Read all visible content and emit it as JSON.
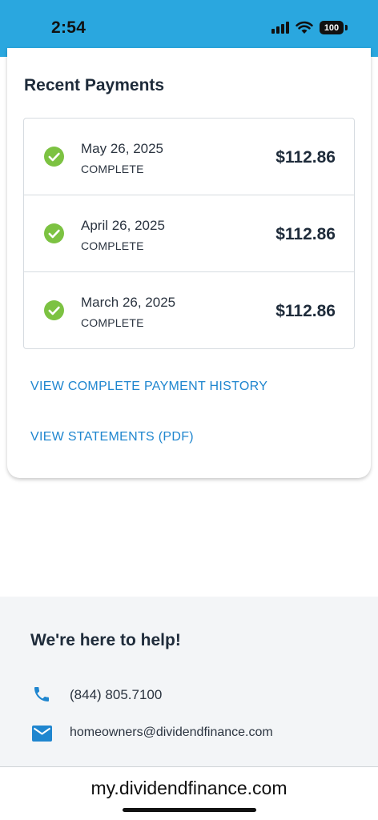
{
  "status_bar": {
    "time": "2:54",
    "battery": "100",
    "background": "#2aa7df"
  },
  "recent_payments": {
    "title": "Recent Payments",
    "items": [
      {
        "date": "May 26, 2025",
        "status": "COMPLETE",
        "amount": "$112.86"
      },
      {
        "date": "April 26, 2025",
        "status": "COMPLETE",
        "amount": "$112.86"
      },
      {
        "date": "March 26, 2025",
        "status": "COMPLETE",
        "amount": "$112.86"
      }
    ],
    "view_history_label": "VIEW COMPLETE PAYMENT HISTORY",
    "view_statements_label": "VIEW STATEMENTS (PDF)"
  },
  "help": {
    "title": "We're here to help!",
    "phone": "(844) 805.7100",
    "email": "homeowners@dividendfinance.com"
  },
  "browser": {
    "url": "my.dividendfinance.com"
  },
  "colors": {
    "accent_link": "#1f86cf",
    "check_green": "#7cc242",
    "icon_blue": "#1f86cf"
  },
  "icons": [
    "check-circle-icon",
    "phone-icon",
    "mail-icon",
    "signal-icon",
    "wifi-icon",
    "battery-icon"
  ]
}
